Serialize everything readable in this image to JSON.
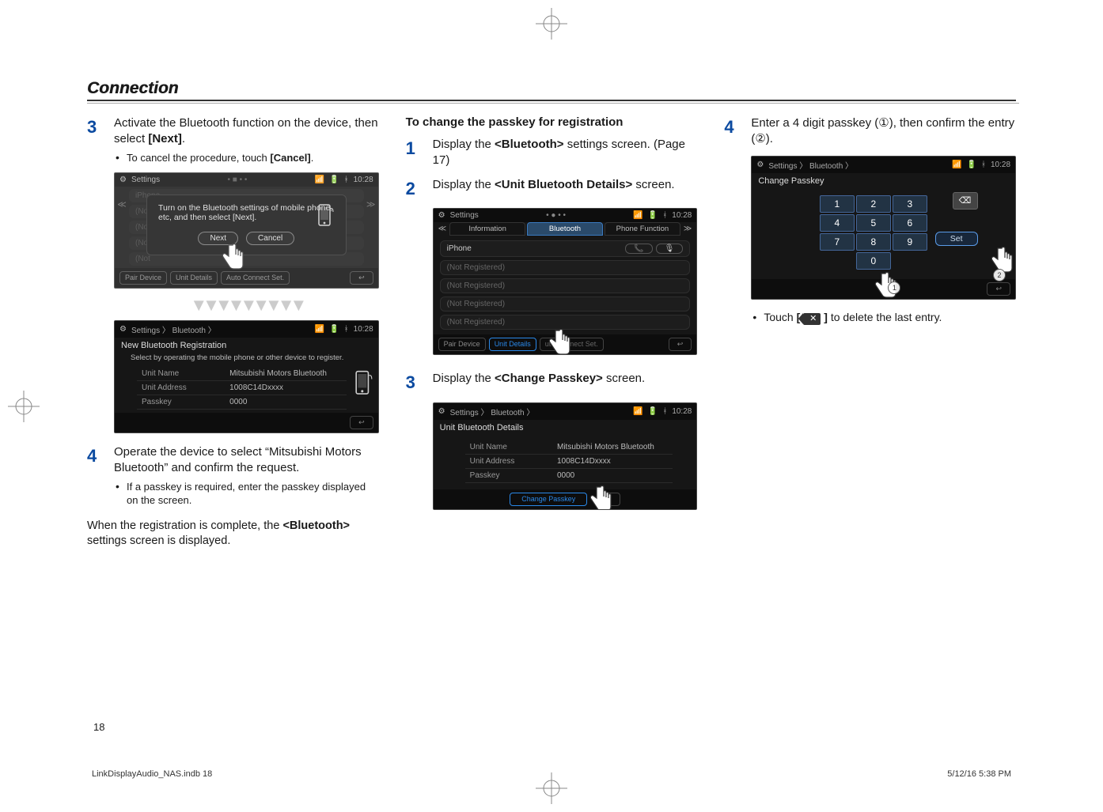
{
  "header": {
    "title": "Connection"
  },
  "col1": {
    "step3": {
      "num": "3",
      "text_a": "Activate the Bluetooth function on the device, then select ",
      "text_b": "[Next]",
      "text_c": ".",
      "bullet": {
        "a": "To cancel the procedure, touch ",
        "b": "[Cancel]",
        "c": "."
      }
    },
    "ss1": {
      "breadcrumb": "Settings",
      "time": "10:28",
      "modal_line1": "Turn on the Bluetooth settings of mobile phone,",
      "modal_line2": "etc, and then select [Next].",
      "btn_next": "Next",
      "btn_cancel": "Cancel",
      "bottom": {
        "pair": "Pair Device",
        "unit": "Unit Details",
        "auto": "Auto Connect Set."
      },
      "side_rows": [
        "iPhone",
        "(Not ",
        "(Not ",
        "(Not ",
        "(Not "
      ]
    },
    "ss2": {
      "breadcrumb": "Settings 〉 Bluetooth 〉",
      "time": "10:28",
      "title": "New Bluetooth Registration",
      "desc": "Select by operating the mobile phone or other device to register.",
      "rows": {
        "unit_name_k": "Unit Name",
        "unit_name_v": "Mitsubishi Motors Bluetooth",
        "unit_addr_k": "Unit Address",
        "unit_addr_v": "1008C14Dxxxx",
        "passkey_k": "Passkey",
        "passkey_v": "0000"
      }
    },
    "step4": {
      "num": "4",
      "text": "Operate the device to select “Mitsubishi Motors Bluetooth” and confirm the request.",
      "bullet": "If a passkey is required, enter the passkey displayed on the screen."
    },
    "completion": {
      "a": "When the registration is complete, the ",
      "b": "<Bluetooth>",
      "c": " settings screen is displayed."
    }
  },
  "col2": {
    "subhead": "To change the passkey for registration",
    "step1": {
      "num": "1",
      "a": "Display the ",
      "b": "<Bluetooth>",
      "c": " settings screen. (Page 17)"
    },
    "step2": {
      "num": "2",
      "a": "Display the ",
      "b": "<Unit Bluetooth Details>",
      "c": " screen."
    },
    "ss3": {
      "breadcrumb": "Settings",
      "time": "10:28",
      "tabs": {
        "info": "Information",
        "bt": "Bluetooth",
        "phone": "Phone Function"
      },
      "rows": [
        "iPhone",
        "(Not Registered)",
        "(Not Registered)",
        "(Not Registered)",
        "(Not Registered)"
      ],
      "bottom": {
        "pair": "Pair Device",
        "unit": "Unit Details",
        "auto": "     uto Connect Set."
      }
    },
    "step3": {
      "num": "3",
      "a": "Display the ",
      "b": "<Change Passkey>",
      "c": " screen."
    },
    "ss4": {
      "breadcrumb": "Settings 〉 Bluetooth 〉",
      "time": "10:28",
      "title": "Unit Bluetooth Details",
      "rows": {
        "unit_name_k": "Unit Name",
        "unit_name_v": "Mitsubishi Motors Bluetooth",
        "unit_addr_k": "Unit Address",
        "unit_addr_v": "1008C14Dxxxx",
        "passkey_k": "Passkey",
        "passkey_v": "0000"
      },
      "change_btn": "Change Passkey"
    }
  },
  "col3": {
    "step4": {
      "num": "4",
      "a": "Enter a 4 digit passkey (",
      "b": "①",
      "c": "), then confirm the entry (",
      "d": "②",
      "e": ")."
    },
    "ss5": {
      "breadcrumb": "Settings 〉 Bluetooth 〉",
      "time": "10:28",
      "title": "Change Passkey",
      "keys": [
        "1",
        "2",
        "3",
        "4",
        "5",
        "6",
        "7",
        "8",
        "9",
        "0"
      ],
      "set": "Set",
      "marker1": "1",
      "marker2": "2"
    },
    "bullet": {
      "a": "Touch ",
      "b": "[ ",
      "c": " ]",
      "d": " to delete the last entry."
    }
  },
  "footer": {
    "page": "18",
    "slug_left": "LinkDisplayAudio_NAS.indb   18",
    "slug_right": "5/12/16   5:38 PM"
  }
}
